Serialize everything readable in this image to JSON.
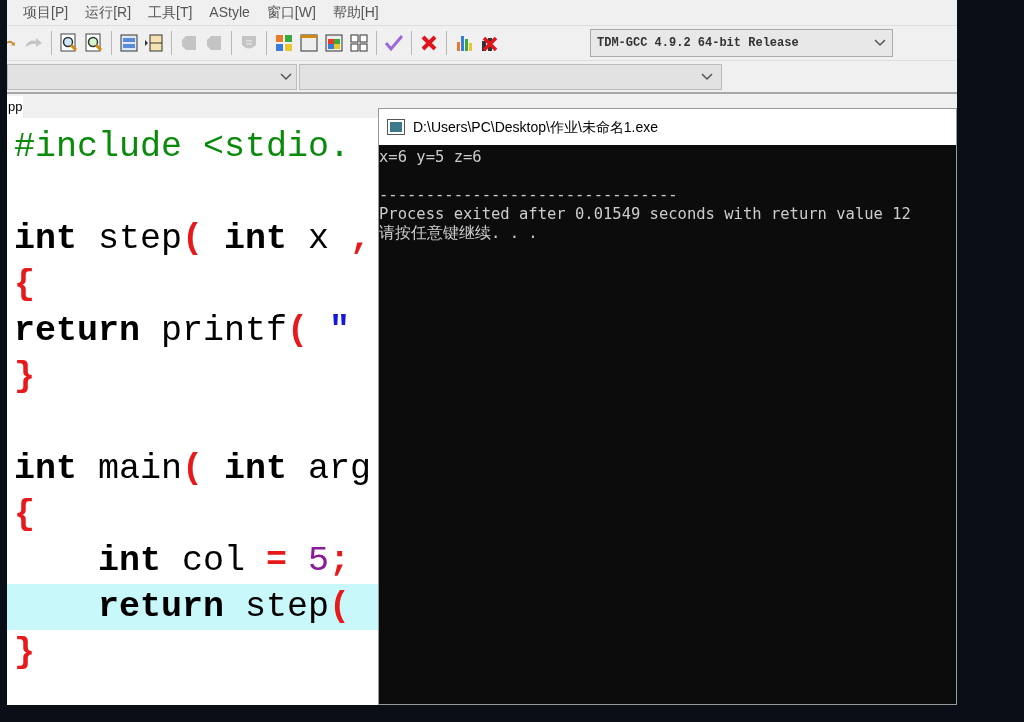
{
  "menu": [
    "项目[P]",
    "运行[R]",
    "工具[T]",
    "AStyle",
    "窗口[W]",
    "帮助[H]"
  ],
  "toolbar": [
    {
      "kind": "undo",
      "disabled": false
    },
    {
      "kind": "redo",
      "disabled": true
    },
    {
      "kind": "sep"
    },
    {
      "kind": "find",
      "disabled": false
    },
    {
      "kind": "find-next",
      "disabled": false
    },
    {
      "kind": "sep"
    },
    {
      "kind": "panel",
      "disabled": false
    },
    {
      "kind": "panel-split",
      "disabled": false
    },
    {
      "kind": "sep"
    },
    {
      "kind": "tag",
      "disabled": true
    },
    {
      "kind": "tag",
      "disabled": true
    },
    {
      "kind": "sep"
    },
    {
      "kind": "shield",
      "disabled": true
    },
    {
      "kind": "sep"
    },
    {
      "kind": "grid-color",
      "disabled": false
    },
    {
      "kind": "window",
      "disabled": false
    },
    {
      "kind": "window-color",
      "disabled": false
    },
    {
      "kind": "grid",
      "disabled": false
    },
    {
      "kind": "sep"
    },
    {
      "kind": "check",
      "disabled": false
    },
    {
      "kind": "sep"
    },
    {
      "kind": "cross",
      "disabled": false
    },
    {
      "kind": "sep"
    },
    {
      "kind": "chart",
      "disabled": false
    },
    {
      "kind": "chart-delete",
      "disabled": false
    }
  ],
  "compiler": "TDM-GCC 4.9.2 64-bit Release",
  "tab": "pp",
  "code": [
    {
      "highlighted": false,
      "tokens": [
        {
          "kind": "pre",
          "text": "#include <stdio."
        }
      ]
    },
    {
      "highlighted": false
    },
    {
      "highlighted": false,
      "tokens": [
        {
          "kind": "kw",
          "text": "int"
        },
        {
          "kind": "plain",
          "text": " step"
        },
        {
          "kind": "paren",
          "text": "( "
        },
        {
          "kind": "kw",
          "text": "int"
        },
        {
          "kind": "plain",
          "text": " x "
        },
        {
          "kind": "op",
          "text": ","
        }
      ]
    },
    {
      "highlighted": false,
      "tokens": [
        {
          "kind": "paren",
          "text": "{"
        }
      ]
    },
    {
      "highlighted": false,
      "tokens": [
        {
          "kind": "kw",
          "text": "return"
        },
        {
          "kind": "plain",
          "text": " printf"
        },
        {
          "kind": "paren",
          "text": "( "
        },
        {
          "kind": "str",
          "text": "\""
        }
      ]
    },
    {
      "highlighted": false,
      "tokens": [
        {
          "kind": "paren",
          "text": "}"
        }
      ]
    },
    {
      "highlighted": false
    },
    {
      "highlighted": false,
      "tokens": [
        {
          "kind": "kw",
          "text": "int"
        },
        {
          "kind": "plain",
          "text": " main"
        },
        {
          "kind": "paren",
          "text": "( "
        },
        {
          "kind": "kw",
          "text": "int"
        },
        {
          "kind": "plain",
          "text": " arg"
        }
      ]
    },
    {
      "highlighted": false,
      "tokens": [
        {
          "kind": "paren",
          "text": "{"
        }
      ]
    },
    {
      "highlighted": false,
      "tokens": [
        {
          "kind": "kw",
          "text": "    int"
        },
        {
          "kind": "plain",
          "text": " col "
        },
        {
          "kind": "op",
          "text": "= "
        },
        {
          "kind": "num",
          "text": "5"
        },
        {
          "kind": "op",
          "text": ";"
        }
      ]
    },
    {
      "highlighted": true,
      "tokens": [
        {
          "kind": "kw",
          "text": "    return"
        },
        {
          "kind": "plain",
          "text": " step"
        },
        {
          "kind": "paren",
          "text": "("
        }
      ]
    },
    {
      "highlighted": false,
      "tokens": [
        {
          "kind": "paren",
          "text": "}"
        }
      ]
    }
  ],
  "console": {
    "title": "D:\\Users\\PC\\Desktop\\作业\\未命名1.exe",
    "lines": [
      "x=6 y=5 z=6",
      "--------------------------------",
      "Process exited after 0.01549 seconds with return value 12",
      "请按任意键继续. . ."
    ]
  }
}
